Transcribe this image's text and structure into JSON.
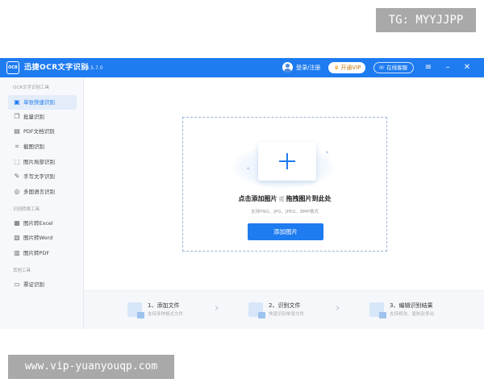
{
  "watermarks": {
    "top": "TG: MYYJJPP",
    "bottom": "www.vip-yuanyouqp.com"
  },
  "titlebar": {
    "logo_text": "OCR",
    "app_name": "迅捷OCR文字识别",
    "version": "v8.5.7.0",
    "login_label": "登录/注册",
    "vip_label": "开通VIP",
    "service_label": "在线客服",
    "menu_icon": "menu-icon",
    "minimize_icon": "minimize-icon",
    "close_icon": "close-icon"
  },
  "sidebar": {
    "groups": [
      {
        "label": "OCR文字识别工具",
        "items": [
          {
            "label": "单张快速识别",
            "icon": "single-image-icon",
            "active": true
          },
          {
            "label": "批量识别",
            "icon": "batch-icon"
          },
          {
            "label": "PDF文档识别",
            "icon": "pdf-doc-icon"
          },
          {
            "label": "截图识别",
            "icon": "crop-icon"
          },
          {
            "label": "图片局部识别",
            "icon": "region-select-icon"
          },
          {
            "label": "手写文字识别",
            "icon": "pen-icon"
          },
          {
            "label": "多国语言识别",
            "icon": "globe-icon"
          }
        ]
      },
      {
        "label": "识别转换工具",
        "items": [
          {
            "label": "图片转Excel",
            "icon": "excel-icon"
          },
          {
            "label": "图片转Word",
            "icon": "word-icon"
          },
          {
            "label": "图片转PDF",
            "icon": "pdf-icon"
          }
        ]
      },
      {
        "label": "其他工具",
        "items": [
          {
            "label": "票证识别",
            "icon": "id-card-icon"
          }
        ]
      }
    ]
  },
  "main": {
    "drop_title_left": "点击添加图片",
    "drop_title_or": "或",
    "drop_title_right": "拖拽图片到此处",
    "drop_hint": "支持PNG、JPG、JPEG、BMP格式",
    "add_button_label": "添加图片"
  },
  "steps": [
    {
      "title": "1、添加文件",
      "desc": "支持多种格式文件"
    },
    {
      "title": "2、识别文件",
      "desc": "快速识别单张文件"
    },
    {
      "title": "3、编辑识别结果",
      "desc": "支持修改、复制及导出"
    }
  ],
  "colors": {
    "accent": "#1e7bf0",
    "vip_text": "#c27c18"
  }
}
